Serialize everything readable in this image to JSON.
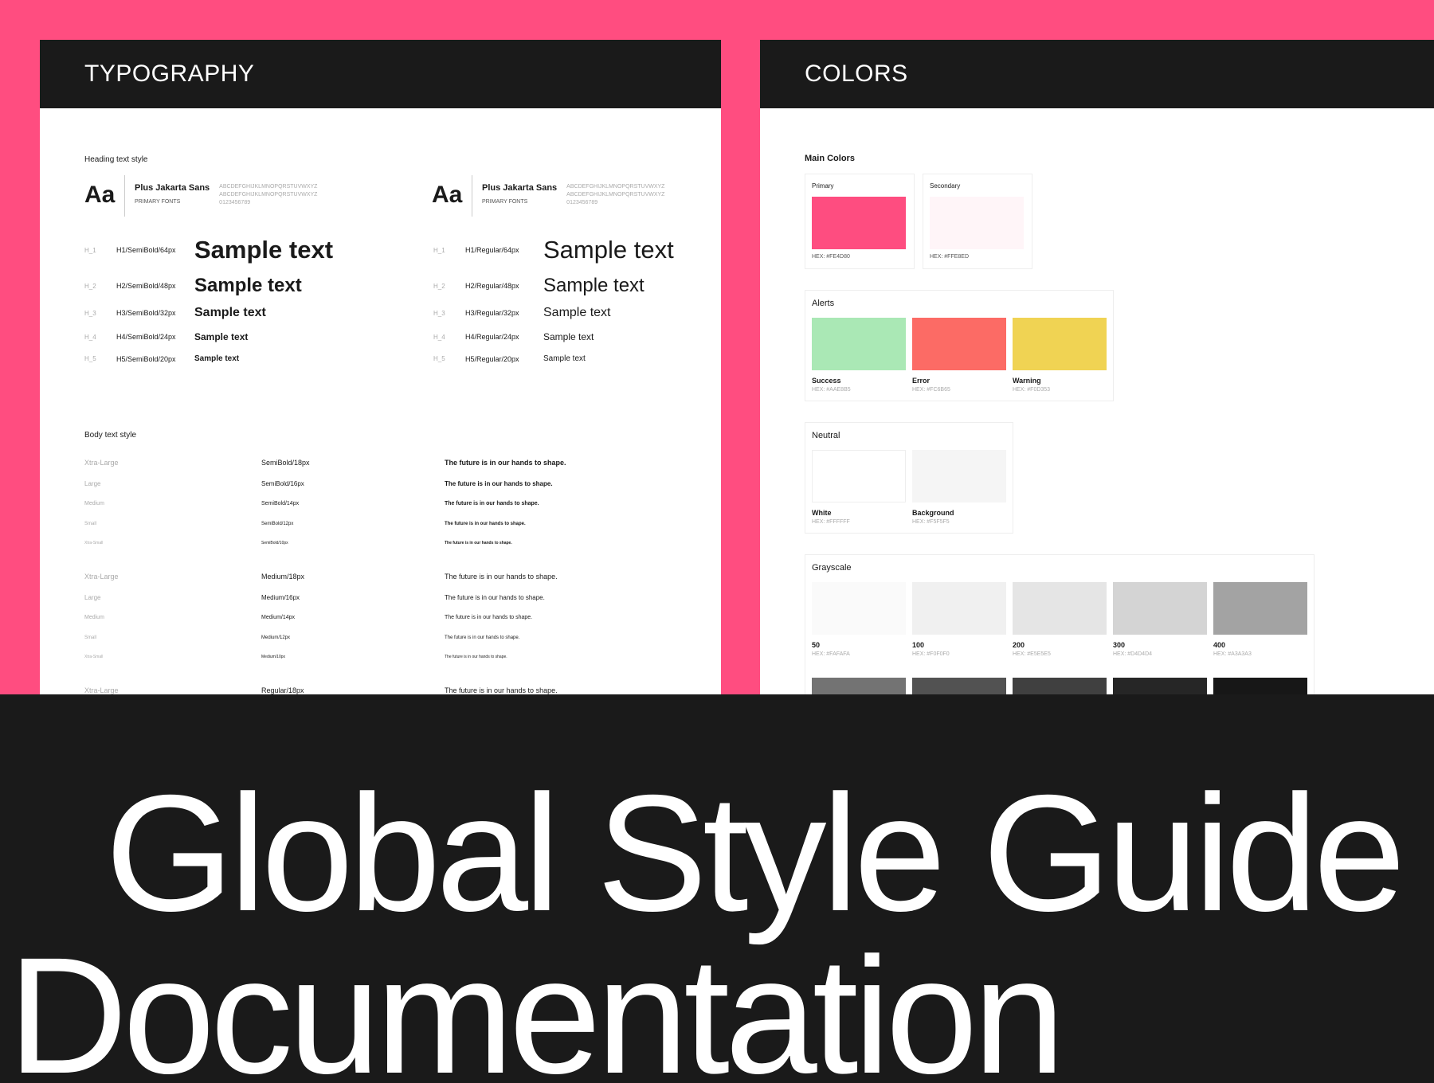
{
  "typography": {
    "header": "TYPOGRAPHY",
    "heading_label": "Heading text style",
    "body_label": "Body text style",
    "font_cards": [
      {
        "aa": "Aa",
        "name": "Plus Jakarta Sans",
        "sub": "PRIMARY FONTS",
        "alpha1": "ABCDEFGHIJKLMNOPQRSTUVWXYZ",
        "alpha2": "ABCDEFGHIJKLMNOPQRSTUVWXYZ",
        "digits": "0123456789"
      },
      {
        "aa": "Aa",
        "name": "Plus Jakarta Sans",
        "sub": "PRIMARY FONTS",
        "alpha1": "ABCDEFGHIJKLMNOPQRSTUVWXYZ",
        "alpha2": "ABCDEFGHIJKLMNOPQRSTUVWXYZ",
        "digits": "0123456789"
      }
    ],
    "headings_left": [
      {
        "tag": "H_1",
        "spec": "H1/SemiBold/64px",
        "sample": "Sample text"
      },
      {
        "tag": "H_2",
        "spec": "H2/SemiBold/48px",
        "sample": "Sample text"
      },
      {
        "tag": "H_3",
        "spec": "H3/SemiBold/32px",
        "sample": "Sample text"
      },
      {
        "tag": "H_4",
        "spec": "H4/SemiBold/24px",
        "sample": "Sample text"
      },
      {
        "tag": "H_5",
        "spec": "H5/SemiBold/20px",
        "sample": "Sample text"
      }
    ],
    "headings_right": [
      {
        "tag": "H_1",
        "spec": "H1/Regular/64px",
        "sample": "Sample text"
      },
      {
        "tag": "H_2",
        "spec": "H2/Regular/48px",
        "sample": "Sample text"
      },
      {
        "tag": "H_3",
        "spec": "H3/Regular/32px",
        "sample": "Sample text"
      },
      {
        "tag": "H_4",
        "spec": "H4/Regular/24px",
        "sample": "Sample text"
      },
      {
        "tag": "H_5",
        "spec": "H5/Regular/20px",
        "sample": "Sample text"
      }
    ],
    "body_rows": [
      {
        "size": "Xtra-Large",
        "spec": "SemiBold/18px",
        "sample": "The future is in our hands to shape."
      },
      {
        "size": "Large",
        "spec": "SemiBold/16px",
        "sample": "The future is in our hands to shape."
      },
      {
        "size": "Medium",
        "spec": "SemiBold/14px",
        "sample": "The future is in our hands to shape."
      },
      {
        "size": "Small",
        "spec": "SemiBold/12px",
        "sample": "The future is in our hands to shape."
      },
      {
        "size": "Xtra-Small",
        "spec": "SemiBold/10px",
        "sample": "The future is in our hands to shape."
      },
      {
        "size": "Xtra-Large",
        "spec": "Medium/18px",
        "sample": "The future is in our hands to shape."
      },
      {
        "size": "Large",
        "spec": "Medium/16px",
        "sample": "The future is in our hands to shape."
      },
      {
        "size": "Medium",
        "spec": "Medium/14px",
        "sample": "The future is in our hands to shape."
      },
      {
        "size": "Small",
        "spec": "Medium/12px",
        "sample": "The future is in our hands to shape."
      },
      {
        "size": "Xtra-Small",
        "spec": "Medium/10px",
        "sample": "The future is in our hands to shape."
      },
      {
        "size": "Xtra-Large",
        "spec": "Regular/18px",
        "sample": "The future is in our hands to shape."
      }
    ]
  },
  "colors": {
    "header": "COLORS",
    "main_title": "Main Colors",
    "main": [
      {
        "name": "Primary",
        "hex_label": "HEX: #FE4D80",
        "color": "#FE4D80"
      },
      {
        "name": "Secondary",
        "hex_label": "HEX: #FFE8ED",
        "color": "#FFF5F8"
      }
    ],
    "alerts_title": "Alerts",
    "alerts": [
      {
        "name": "Success",
        "hex_label": "HEX: #AAE8B5",
        "color": "#AAE8B5"
      },
      {
        "name": "Error",
        "hex_label": "HEX: #FC6B65",
        "color": "#FC6B65"
      },
      {
        "name": "Warning",
        "hex_label": "HEX: #F0D353",
        "color": "#F0D353"
      }
    ],
    "neutral_title": "Neutral",
    "neutral": [
      {
        "name": "White",
        "hex_label": "HEX: #FFFFFF",
        "color": "#FFFFFF"
      },
      {
        "name": "Background",
        "hex_label": "HEX: #F5F5F5",
        "color": "#F5F5F5"
      }
    ],
    "grayscale_title": "Grayscale",
    "grayscale": [
      {
        "name": "50",
        "hex_label": "HEX: #FAFAFA",
        "color": "#FAFAFA"
      },
      {
        "name": "100",
        "hex_label": "HEX: #F0F0F0",
        "color": "#F0F0F0"
      },
      {
        "name": "200",
        "hex_label": "HEX: #E5E5E5",
        "color": "#E5E5E5"
      },
      {
        "name": "300",
        "hex_label": "HEX: #D4D4D4",
        "color": "#D4D4D4"
      },
      {
        "name": "400",
        "hex_label": "HEX: #A3A3A3",
        "color": "#A3A3A3"
      }
    ],
    "grayscale_dark": [
      "#737373",
      "#525252",
      "#404040",
      "#262626",
      "#171717"
    ]
  },
  "banner": {
    "line1": "Global Style Guide",
    "line2": "Documentation"
  }
}
